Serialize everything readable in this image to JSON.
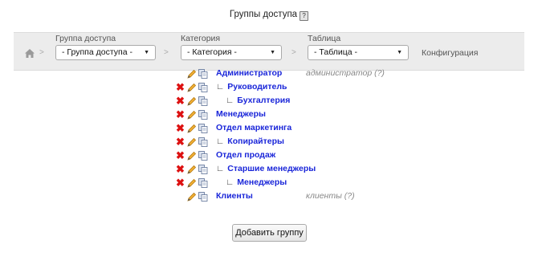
{
  "title": "Группы доступа",
  "title_help": "?",
  "navbar": {
    "separator": ">",
    "group_label": "Группа доступа",
    "group_value": "- Группа доступа -",
    "category_label": "Категория",
    "category_value": "- Категория -",
    "table_label": "Таблица",
    "table_value": "- Таблица -",
    "config_label": "Конфигурация"
  },
  "tree": [
    {
      "name": "Администратор",
      "branch": "",
      "deletable": false,
      "description": "администратор (?)"
    },
    {
      "name": "Руководитель",
      "branch": "∟",
      "deletable": true,
      "description": ""
    },
    {
      "name": "Бухгалтерия",
      "branch": "∟",
      "deletable": true,
      "description": ""
    },
    {
      "name": "Менеджеры",
      "branch": "",
      "deletable": true,
      "description": ""
    },
    {
      "name": "Отдел маркетинга",
      "branch": "",
      "deletable": true,
      "description": ""
    },
    {
      "name": "Копирайтеры",
      "branch": "∟",
      "deletable": true,
      "description": ""
    },
    {
      "name": "Отдел продаж",
      "branch": "",
      "deletable": true,
      "description": ""
    },
    {
      "name": "Старшие менеджеры",
      "branch": "∟",
      "deletable": true,
      "description": ""
    },
    {
      "name": "Менеджеры",
      "branch": "∟",
      "deletable": true,
      "description": ""
    },
    {
      "name": "Клиенты",
      "branch": "",
      "deletable": false,
      "description": "клиенты (?)"
    }
  ],
  "add_button": "Добавить группу",
  "colors": {
    "link": "#1a26d9",
    "delete": "#dd1111",
    "navbar_bg": "#ececec"
  },
  "icons": {
    "delete": "delete-icon",
    "edit": "pencil-icon",
    "copy": "copy-icon",
    "home": "home-icon",
    "dropdown": "chevron-down-icon"
  }
}
